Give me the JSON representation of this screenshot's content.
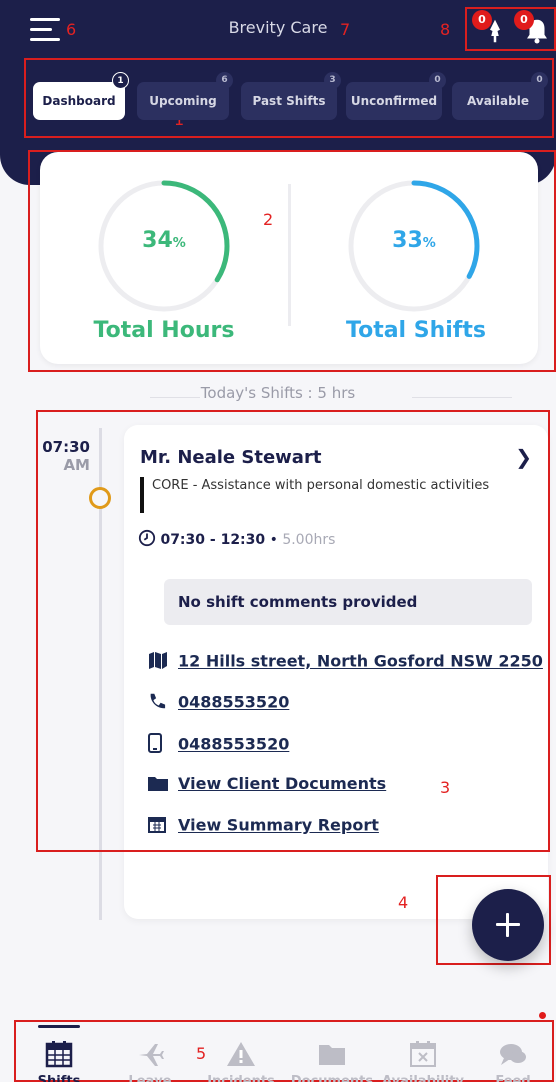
{
  "header": {
    "title": "Brevity Care",
    "notification_counts": [
      "0",
      "0"
    ]
  },
  "tabs": [
    {
      "label": "Dashboard",
      "count": "1",
      "active": true
    },
    {
      "label": "Upcoming",
      "count": "6"
    },
    {
      "label": "Past Shifts",
      "count": "3"
    },
    {
      "label": "Unconfirmed",
      "count": "0"
    },
    {
      "label": "Available",
      "count": "0"
    }
  ],
  "stats": {
    "hours": {
      "value": "34",
      "unit": "%",
      "label": "Total Hours",
      "fraction": 0.34,
      "color": "#3cb87a"
    },
    "shifts": {
      "value": "33",
      "unit": "%",
      "label": "Total Shifts",
      "fraction": 0.33,
      "color": "#2fa6e8"
    }
  },
  "today_label": "Today's Shifts : 5 hrs",
  "shift": {
    "time": "07:30",
    "ampm": "AM",
    "client": "Mr. Neale Stewart",
    "service": "CORE - Assistance with personal domestic activities",
    "time_range": "07:30 - 12:30",
    "duration": "5.00hrs",
    "comments": "No shift comments provided",
    "address": "12 Hills street, North Gosford NSW 2250",
    "phone": "0488553520",
    "mobile": "0488553520",
    "documents_link": "View Client Documents",
    "report_link": "View Summary Report"
  },
  "bottom_nav": [
    {
      "label": "Shifts",
      "icon": "calendar-icon",
      "active": true
    },
    {
      "label": "Leave",
      "icon": "plane-icon"
    },
    {
      "label": "Incidents",
      "icon": "warning-icon"
    },
    {
      "label": "Documents",
      "icon": "folder-icon"
    },
    {
      "label": "Availability",
      "icon": "calendar-x-icon"
    },
    {
      "label": "Feed",
      "icon": "chat-icon"
    }
  ],
  "annotations": [
    "1",
    "2",
    "3",
    "4",
    "5",
    "6",
    "7",
    "8"
  ],
  "colors": {
    "brand": "#1c1f4a",
    "accent_green": "#3cb87a",
    "accent_blue": "#2fa6e8",
    "marker_orange": "#e09a1a",
    "annotation_red": "#d91e1e"
  }
}
